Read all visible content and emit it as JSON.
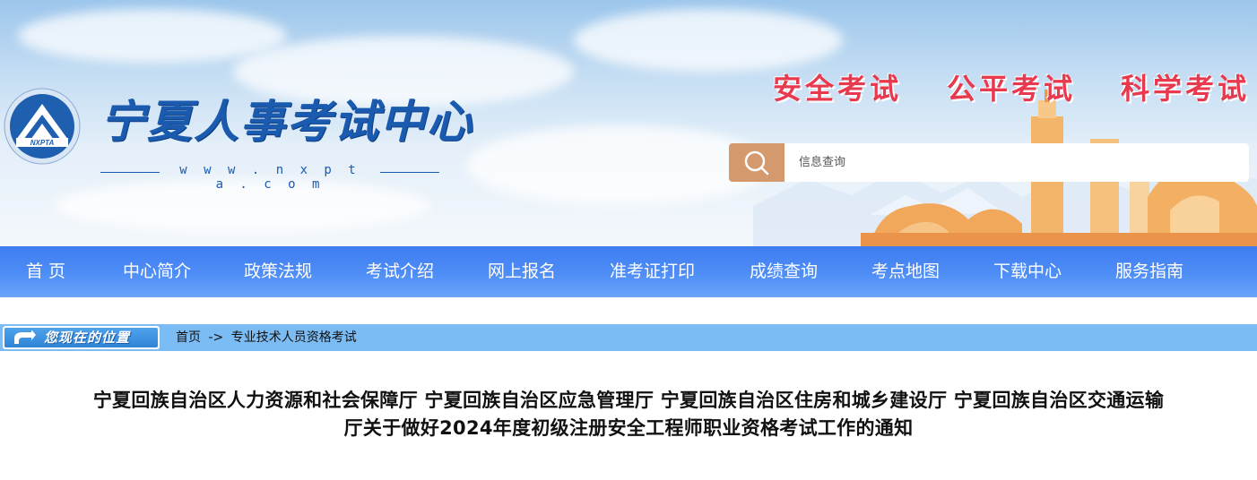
{
  "header": {
    "site_title": "宁夏人事考试中心",
    "logo_text": "NXPTA",
    "site_url": "w w w . n x p t a . c o m",
    "slogans": [
      "安全考试",
      "公平考试",
      "科学考试"
    ]
  },
  "search": {
    "placeholder": "信息查询",
    "value": "",
    "icon": "search-icon"
  },
  "nav": {
    "items": [
      {
        "label": "首 页"
      },
      {
        "label": "中心简介"
      },
      {
        "label": "政策法规"
      },
      {
        "label": "考试介绍"
      },
      {
        "label": "网上报名"
      },
      {
        "label": "准考证打印"
      },
      {
        "label": "成绩查询"
      },
      {
        "label": "考点地图"
      },
      {
        "label": "下载中心"
      },
      {
        "label": "服务指南"
      }
    ]
  },
  "breadcrumb": {
    "location_label": "您现在的位置",
    "home": "首页",
    "separator": "->",
    "current": "专业技术人员资格考试"
  },
  "article": {
    "title_line1": "宁夏回族自治区人力资源和社会保障厅 宁夏回族自治区应急管理厅 宁夏回族自治区住房和城乡建设厅 宁夏回族自治区交通运输",
    "title_line2": "厅关于做好2024年度初级注册安全工程师职业资格考试工作的通知"
  },
  "colors": {
    "nav_blue": "#4f8ef6",
    "slogan_red": "#e83a4e",
    "search_button": "#d49a6e",
    "breadcrumb_bar": "#7bbcf5",
    "brand_blue": "#1a5bb0"
  }
}
